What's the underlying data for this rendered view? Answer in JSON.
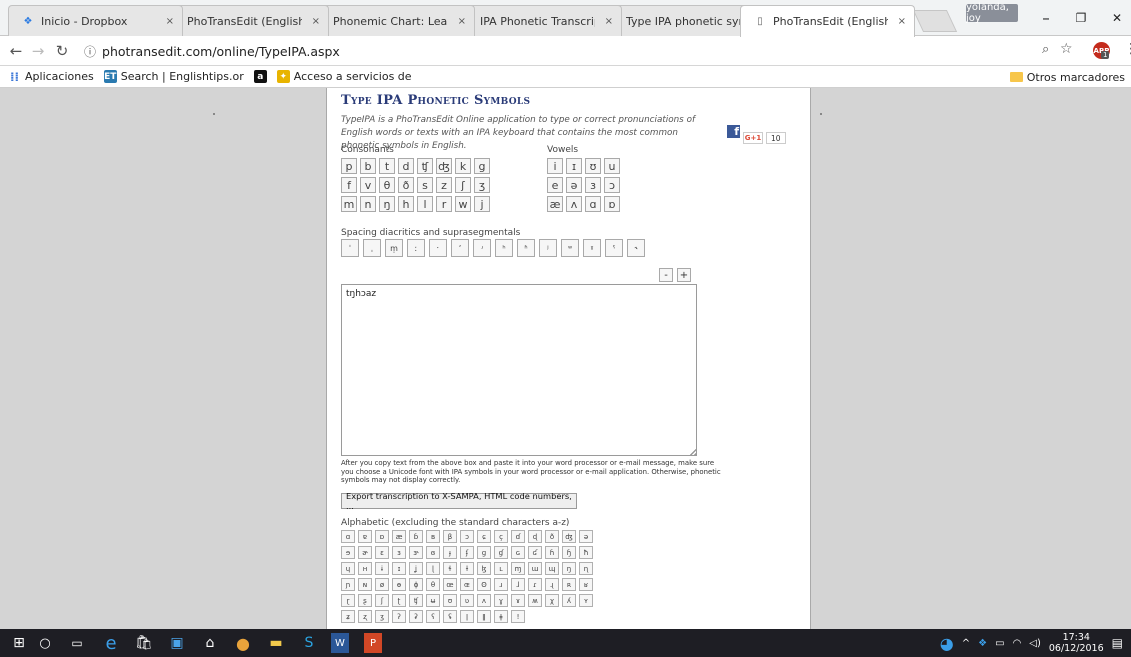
{
  "browser": {
    "tabs": [
      {
        "title": "Inicio - Dropbox",
        "icon": "dropbox-icon",
        "active": false
      },
      {
        "title": "PhoTransEdit (English",
        "icon": "page-icon",
        "active": false
      },
      {
        "title": "Phonemic Chart: Learn",
        "icon": "page-icon",
        "active": false
      },
      {
        "title": "IPA Phonetic Transcrip",
        "icon": "ipa-icon",
        "active": false
      },
      {
        "title": "Type IPA phonetic sym",
        "icon": "site-icon",
        "active": false
      },
      {
        "title": "PhoTransEdit (English",
        "icon": "page-icon",
        "active": true
      }
    ],
    "tab_close": "×",
    "profile_name": "yolanda, joy",
    "window_controls": {
      "minimize": "–",
      "maximize": "❐",
      "close": "✕"
    },
    "url": "photransedit.com/online/TypeIPA.aspx",
    "abp_count": "1",
    "bookmarks": [
      {
        "label": "Aplicaciones",
        "icon": "apps-grid-icon"
      },
      {
        "label": "Search | Englishtips.or",
        "icon": "englishtips-icon"
      },
      {
        "label": "",
        "icon": "amazon-icon"
      },
      {
        "label": "Acceso a servicios de",
        "icon": "services-icon"
      }
    ],
    "other_bookmarks": "Otros marcadores"
  },
  "page": {
    "title": "Type IPA Phonetic Symbols",
    "intro": "TypeIPA is a PhoTransEdit Online application to type or correct pronunciations of English words or texts with an IPA keyboard that contains the most common phonetic symbols in English.",
    "gplus_label": "G+1",
    "gplus_count": "10",
    "consonants_label": "Consonants",
    "vowels_label": "Vowels",
    "consonants": [
      "p",
      "b",
      "t",
      "d",
      "ʧ",
      "ʤ",
      "k",
      "g",
      "f",
      "v",
      "θ",
      "ð",
      "s",
      "z",
      "ʃ",
      "ʒ",
      "m",
      "n",
      "ŋ",
      "h",
      "l",
      "r",
      "w",
      "j"
    ],
    "vowels": [
      "i",
      "ɪ",
      "ʊ",
      "u",
      "e",
      "ə",
      "ɜ",
      "ɔ",
      "æ",
      "ʌ",
      "ɑ",
      "ɒ"
    ],
    "diacritics_label": "Spacing diacritics and suprasegmentals",
    "diacritics": [
      "ˈ",
      "ˌ",
      "m̩",
      "ː",
      "ˑ",
      "ʼ",
      "ʴ",
      "ʰ",
      "ʱ",
      "ʲ",
      "ʷ",
      "ˠ",
      "ˤ",
      "˞"
    ],
    "text_value": "tŋhɔaz",
    "minus_label": "-",
    "plus_label": "+",
    "note": "After you copy text from the above box and paste it into your word processor or e-mail message, make sure you choose a Unicode font with IPA symbols in your word processor or e-mail application. Otherwise, phonetic symbols may not display correctly.",
    "export_label": "Export transcription to X-SAMPA, HTML code numbers, ...",
    "alphabetic_label": "Alphabetic (excluding the standard characters a-z)",
    "alphabetic": [
      "ɑ",
      "ɐ",
      "ɒ",
      "æ",
      "ɓ",
      "ʙ",
      "β",
      "ɔ",
      "ɕ",
      "ç",
      "ɗ",
      "ɖ",
      "ð",
      "ʤ",
      "ə",
      "ɘ",
      "ɚ",
      "ɛ",
      "ɜ",
      "ɝ",
      "ɞ",
      "ɟ",
      "ʄ",
      "ɡ",
      "ɠ",
      "ɢ",
      "ʛ",
      "ɦ",
      "ɧ",
      "ħ",
      "ɥ",
      "ʜ",
      "ɨ",
      "ɪ",
      "ʝ",
      "ɭ",
      "ɬ",
      "ɫ",
      "ɮ",
      "ʟ",
      "ɱ",
      "ɯ",
      "ɰ",
      "ŋ",
      "ɳ",
      "ɲ",
      "ɴ",
      "ø",
      "ɵ",
      "ɸ",
      "θ",
      "œ",
      "ɶ",
      "ʘ",
      "ɹ",
      "ɺ",
      "ɾ",
      "ɻ",
      "ʀ",
      "ʁ",
      "ɽ",
      "ʂ",
      "ʃ",
      "ʈ",
      "ʧ",
      "ʉ",
      "ʊ",
      "ʋ",
      "ʌ",
      "ɣ",
      "ɤ",
      "ʍ",
      "χ",
      "ʎ",
      "ʏ",
      "ʑ",
      "ʐ",
      "ʒ",
      "ʔ",
      "ʡ",
      "ʕ",
      "ʢ",
      "ǀ",
      "ǁ",
      "ǂ",
      "ǃ"
    ]
  },
  "taskbar": {
    "time": "17:34",
    "date": "06/12/2016"
  }
}
